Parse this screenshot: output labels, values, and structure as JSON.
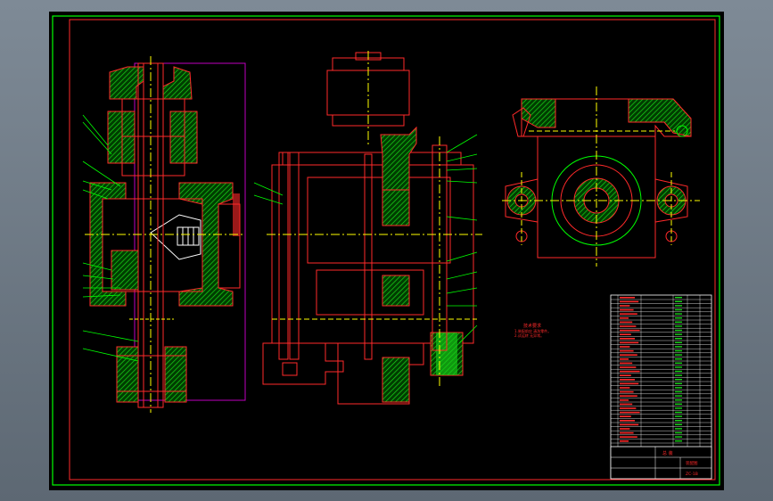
{
  "drawing": {
    "background": "#000000",
    "frame_color": "#00ff00",
    "part_color": "#ff0000",
    "hatch_color": "#00cc00",
    "center_color": "#ffff00",
    "section_color": "#c000c0",
    "title_block": {
      "title": "总 装",
      "sheet_label": "装配图",
      "drawing_no": "ZC-1B"
    },
    "tech_notes": {
      "heading": "技术要求",
      "lines": [
        "1.装配前应 清洗零件。",
        "2.试运转 无异常。"
      ]
    }
  }
}
